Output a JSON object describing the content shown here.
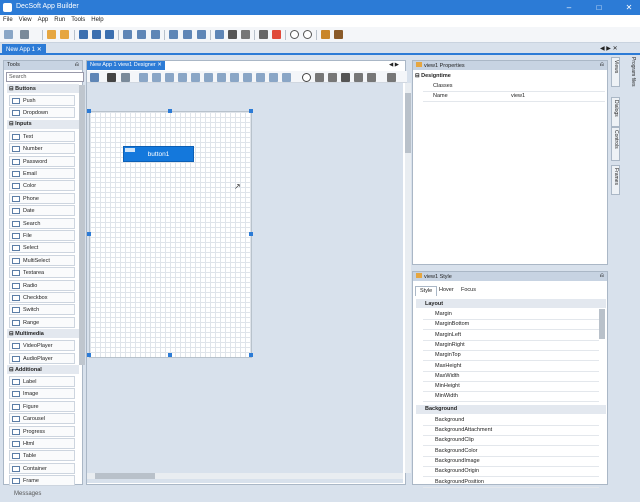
{
  "window": {
    "title": "DecSoft App Builder"
  },
  "menu": [
    "File",
    "View",
    "App",
    "Run",
    "Tools",
    "Help"
  ],
  "doc_tabs": [
    "New App 1"
  ],
  "tools_panel": {
    "title": "Tools",
    "search_placeholder": "Search",
    "categories": [
      {
        "name": "Buttons",
        "items": [
          "Push",
          "Dropdown"
        ]
      },
      {
        "name": "Inputs",
        "items": [
          "Text",
          "Number",
          "Password",
          "Email",
          "Color",
          "Phone",
          "Date",
          "Search",
          "File",
          "Select",
          "MultiSelect",
          "Textarea",
          "Radio",
          "Checkbox",
          "Switch",
          "Range"
        ]
      },
      {
        "name": "Multimedia",
        "items": [
          "VideoPlayer",
          "AudioPlayer"
        ]
      },
      {
        "name": "Additional",
        "items": [
          "Label",
          "Image",
          "Figure",
          "Carousel",
          "Progress",
          "Html",
          "Table",
          "Container",
          "Frame"
        ]
      }
    ]
  },
  "designer": {
    "tab": "New App 1 view1 Designer",
    "button_label": "button1"
  },
  "properties": {
    "title": "view1 Properties",
    "section": "Designtime",
    "rows": [
      {
        "name": "Classes",
        "value": ""
      },
      {
        "name": "Name",
        "value": "view1"
      }
    ]
  },
  "style_panel": {
    "title": "view1 Style",
    "tabs": [
      "Style",
      "Hover",
      "Focus"
    ],
    "sections": [
      {
        "name": "Layout",
        "rows": [
          "Margin",
          "MarginBottom",
          "MarginLeft",
          "MarginRight",
          "MarginTop",
          "MaxHeight",
          "MaxWidth",
          "MinHeight",
          "MinWidth"
        ]
      },
      {
        "name": "Background",
        "rows": [
          "Background",
          "BackgroundAttachment",
          "BackgroundClip",
          "BackgroundColor",
          "BackgroundImage",
          "BackgroundOrigin",
          "BackgroundPosition"
        ]
      }
    ]
  },
  "right_tabs": [
    "Views",
    "Dialogs",
    "Controls",
    "Frames"
  ],
  "right_tabs2": [
    "Program files"
  ],
  "status": {
    "messages": "Messages"
  },
  "colors": {
    "accent": "#2c7bd6",
    "button": "#1478dc"
  }
}
